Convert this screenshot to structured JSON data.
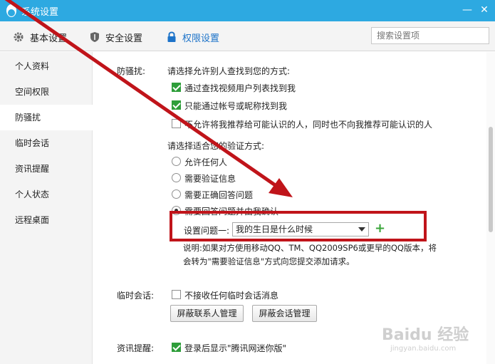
{
  "window": {
    "title": "系统设置",
    "minimize": "—",
    "close": "✕"
  },
  "tabs": [
    {
      "label": "基本设置",
      "icon": "gear-icon"
    },
    {
      "label": "安全设置",
      "icon": "shield-icon"
    },
    {
      "label": "权限设置",
      "icon": "lock-icon"
    }
  ],
  "search": {
    "placeholder": "搜索设置项"
  },
  "sidebar": {
    "items": [
      {
        "label": "个人资料"
      },
      {
        "label": "空间权限"
      },
      {
        "label": "防骚扰"
      },
      {
        "label": "临时会话"
      },
      {
        "label": "资讯提醒"
      },
      {
        "label": "个人状态"
      },
      {
        "label": "远程桌面"
      }
    ],
    "active_index": 2
  },
  "anti_harass": {
    "label": "防骚扰:",
    "find_prompt": "请选择允许别人查找到您的方式:",
    "find_options": [
      {
        "label": "通过查找视频用户列表找到我",
        "checked": true
      },
      {
        "label": "只能通过帐号或昵称找到我",
        "checked": true
      },
      {
        "label": "不允许将我推荐给可能认识的人，同时也不向我推荐可能认识的人",
        "checked": false
      }
    ],
    "verify_prompt": "请选择适合您的验证方式:",
    "verify_options": [
      {
        "label": "允许任何人",
        "checked": false
      },
      {
        "label": "需要验证信息",
        "checked": false
      },
      {
        "label": "需要正确回答问题",
        "checked": false
      },
      {
        "label": "需要回答问题并由我确认",
        "checked": true
      }
    ],
    "question_label": "设置问题一:",
    "question_value": "我的生日是什么时候",
    "add_symbol": "+",
    "note_line1": "说明:如果对方使用移动QQ、TM、QQ2009SP6或更早的QQ版本，将",
    "note_line2": "会转为\"需要验证信息\"方式向您提交添加请求。"
  },
  "temp_session": {
    "label": "临时会话:",
    "option": {
      "label": "不接收任何临时会话消息",
      "checked": false
    },
    "btn_contacts": "屏蔽联系人管理",
    "btn_sessions": "屏蔽会话管理"
  },
  "news": {
    "label": "资讯提醒:",
    "option": {
      "label": "登录后显示\"腾讯网迷你版\"",
      "checked": true
    }
  },
  "watermark": {
    "text": "Baidu 经验",
    "url": "jingyan.baidu.com"
  },
  "colors": {
    "titlebar": "#2da9e1",
    "active_tab": "#1d73c9",
    "checkbox": "#2e9e3a",
    "annotation": "#c0141a"
  }
}
